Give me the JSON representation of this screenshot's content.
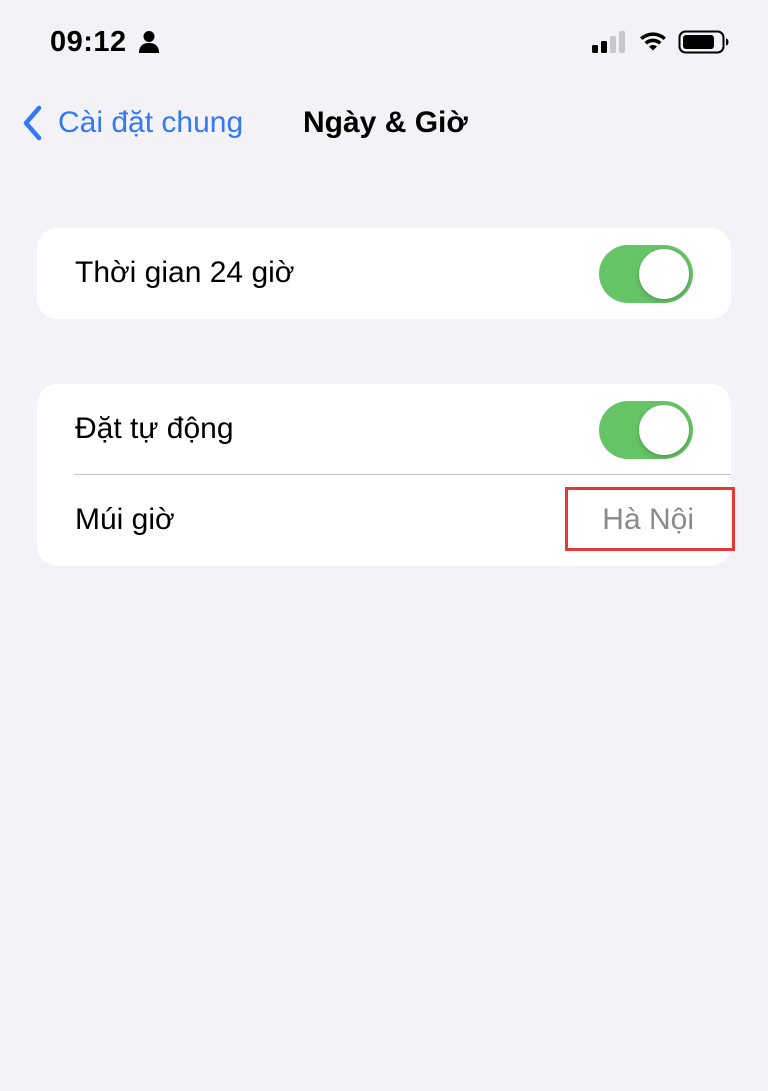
{
  "status_bar": {
    "time": "09:12",
    "icons": [
      "person-icon",
      "signal-icon",
      "wifi-icon",
      "battery-icon"
    ]
  },
  "nav": {
    "back_label": "Cài đặt chung",
    "title": "Ngày & Giờ",
    "back_icon": "chevron-left-icon"
  },
  "groups": [
    {
      "rows": [
        {
          "label": "Thời gian 24 giờ",
          "type": "toggle",
          "on": true
        }
      ]
    },
    {
      "rows": [
        {
          "label": "Đặt tự động",
          "type": "toggle",
          "on": true
        },
        {
          "label": "Múi giờ",
          "type": "value",
          "value": "Hà Nội"
        }
      ]
    }
  ],
  "colors": {
    "background": "#f2f2f7",
    "accent": "#3478f6",
    "toggle_on": "#65c466",
    "secondary_text": "#8a8a8e",
    "highlight": "#e53935"
  }
}
